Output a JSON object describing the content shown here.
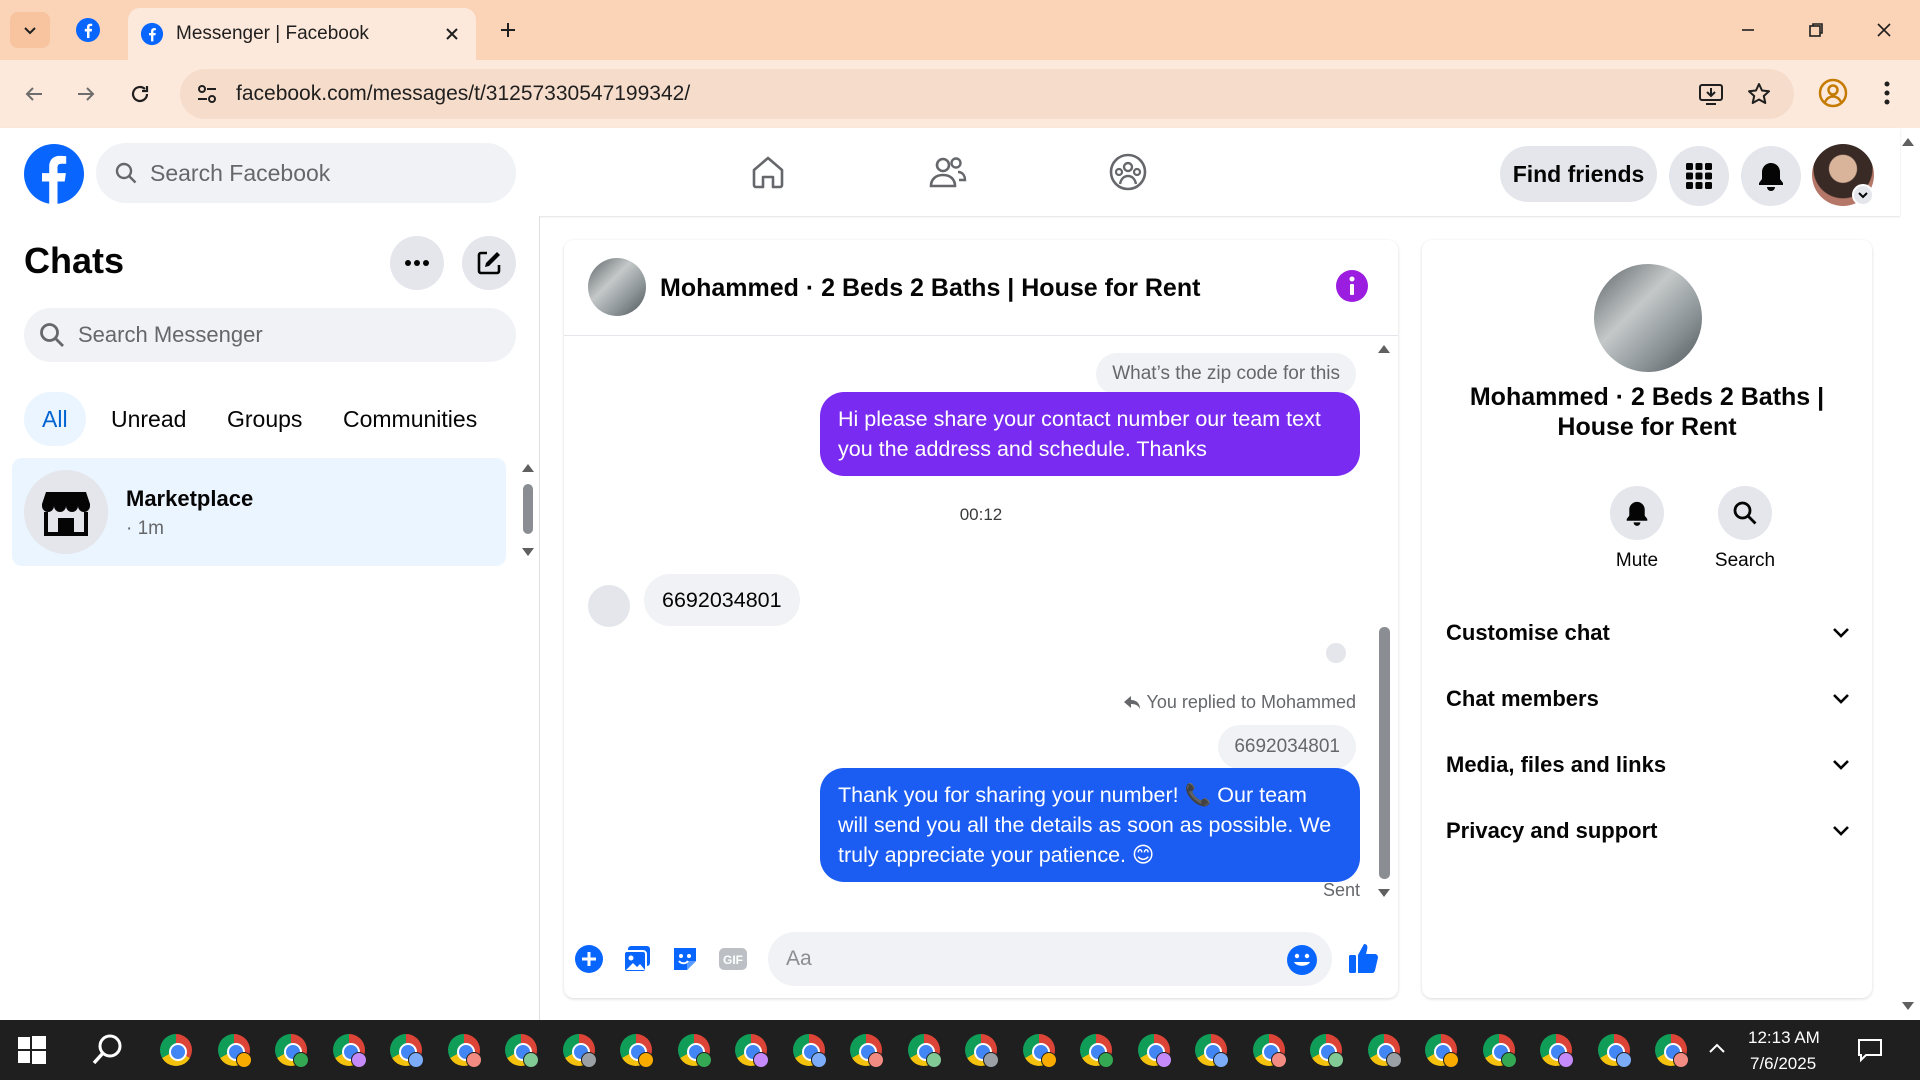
{
  "browser": {
    "tab_title": "Messenger | Facebook",
    "url": "facebook.com/messages/t/31257330547199342/"
  },
  "fb": {
    "search_placeholder": "Search Facebook",
    "find_friends": "Find friends"
  },
  "left": {
    "title": "Chats",
    "search_placeholder": "Search Messenger",
    "filters": [
      "All",
      "Unread",
      "Groups",
      "Communities"
    ],
    "chat": {
      "name": "Marketplace",
      "time": "· 1m"
    }
  },
  "convo": {
    "title": "Mohammed · 2 Beds 2 Baths | House for Rent",
    "msg_zip": "What’s the zip code for this",
    "msg_out1": "Hi please share your contact number our team text you the address and schedule. Thanks",
    "timestamp": "00:12",
    "msg_in": "6692034801",
    "reply_note": "You replied to Mohammed",
    "quote": "6692034801",
    "msg_out2": "Thank you for sharing your number! 📞 Our team will send you all the details as soon as possible. We truly appreciate your patience. 😊",
    "status": "Sent",
    "input_placeholder": "Aa"
  },
  "right": {
    "name": "Mohammed · 2 Beds 2 Baths | House for Rent",
    "mute": "Mute",
    "search": "Search",
    "sections": [
      "Customise chat",
      "Chat members",
      "Media, files and links",
      "Privacy and support"
    ]
  },
  "taskbar": {
    "time": "12:13 AM",
    "date": "7/6/2025"
  },
  "colors": {
    "fb_blue": "#0866ff",
    "bubble_purple": "#7a2bf1",
    "bubble_blue": "#1b5cf2",
    "tab_bar": "#fbd3b6"
  }
}
